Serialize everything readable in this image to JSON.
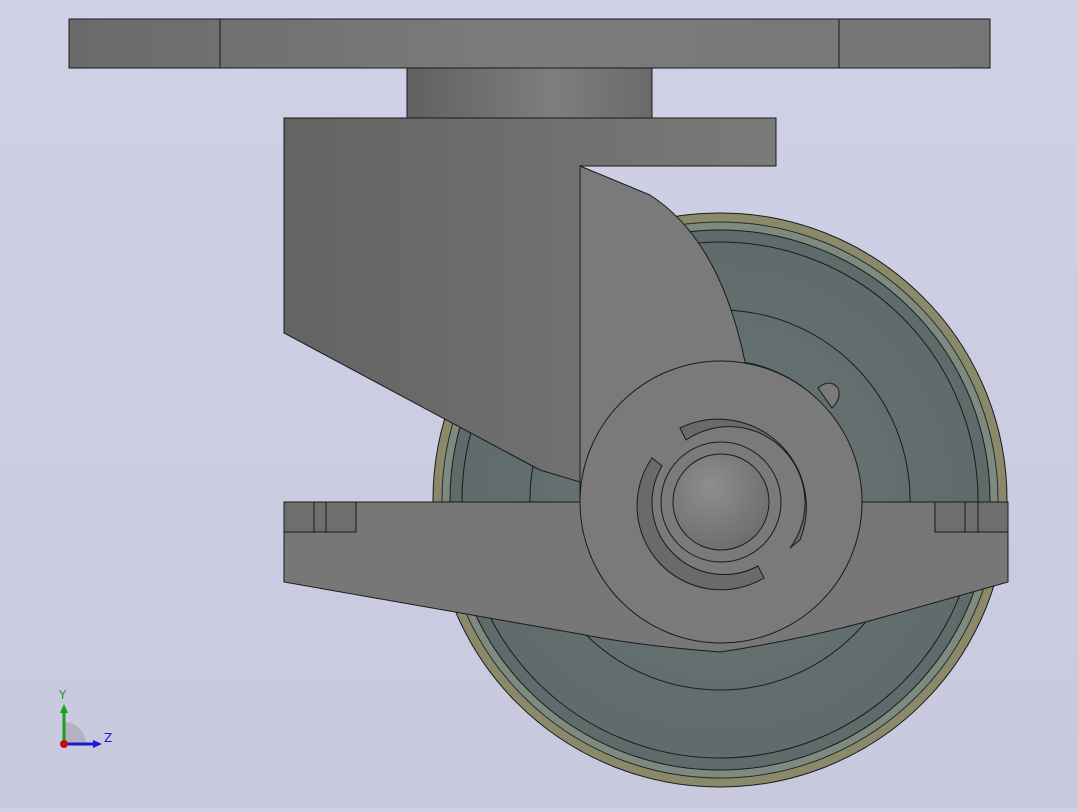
{
  "view": {
    "background_top": "#d0d0e6",
    "background_bottom": "#c8c8de"
  },
  "model": {
    "name": "swivel-caster",
    "colors": {
      "plate": "#7a7a7a",
      "plate_dark": "#6a6a6a",
      "bearing": "#737373",
      "fork": "#6e6e6e",
      "fork_light": "#858585",
      "wheel_tread": "#8a8a6e",
      "wheel_rim": "#6c7676",
      "wheel_hub": "#657070",
      "axle_cap": "#7a7a7a",
      "edge": "#1a1a1a"
    }
  },
  "triad": {
    "y_label": "Y",
    "z_label": "Z",
    "y_color": "#1aa01a",
    "z_color": "#1a1ad0",
    "origin_color": "#c01010"
  }
}
